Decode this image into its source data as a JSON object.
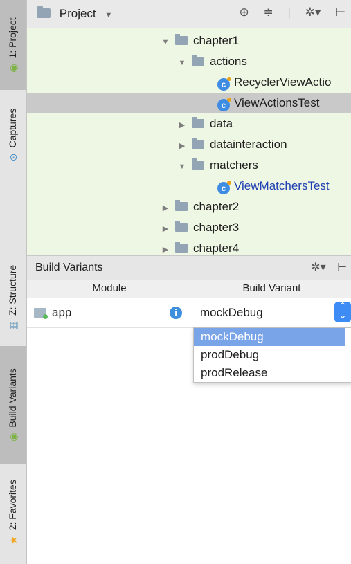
{
  "tool_windows": [
    {
      "label": "1: Project",
      "active": true
    },
    {
      "label": "Captures",
      "active": false
    },
    {
      "label": "Z: Structure",
      "active": false
    },
    {
      "label": "Build Variants",
      "active": true
    },
    {
      "label": "2: Favorites",
      "active": false
    }
  ],
  "project": {
    "title": "Project",
    "dropdown_icon": "chevron-down-icon",
    "toolbar_icons": [
      "target-icon",
      "collapse-icon",
      "gear-icon",
      "hide-icon"
    ],
    "tree": [
      {
        "label": "chapter1",
        "type": "folder",
        "expanded": true
      },
      {
        "label": "actions",
        "type": "folder",
        "expanded": true
      },
      {
        "label": "RecyclerViewActio",
        "type": "class"
      },
      {
        "label": "ViewActionsTest",
        "type": "class",
        "selected": true
      },
      {
        "label": "data",
        "type": "folder",
        "expanded": false
      },
      {
        "label": "datainteraction",
        "type": "folder",
        "expanded": false
      },
      {
        "label": "matchers",
        "type": "folder",
        "expanded": true
      },
      {
        "label": "ViewMatchersTest",
        "type": "class"
      },
      {
        "label": "chapter2",
        "type": "folder",
        "expanded": false
      },
      {
        "label": "chapter3",
        "type": "folder",
        "expanded": false
      },
      {
        "label": "chapter4",
        "type": "folder",
        "expanded": false
      }
    ]
  },
  "build_variants": {
    "title": "Build Variants",
    "columns": [
      "Module",
      "Build Variant"
    ],
    "rows": [
      {
        "module": "app",
        "variant": "mockDebug"
      }
    ],
    "options": [
      "mockDebug",
      "prodDebug",
      "prodRelease"
    ],
    "selected_option": "mockDebug"
  },
  "colors": {
    "tree_background": "#eef7e3",
    "selection": "#c9c9c9",
    "accent": "#3d8bf5",
    "option_highlight": "#7aa4e8",
    "class_link": "#1f3fb3"
  }
}
